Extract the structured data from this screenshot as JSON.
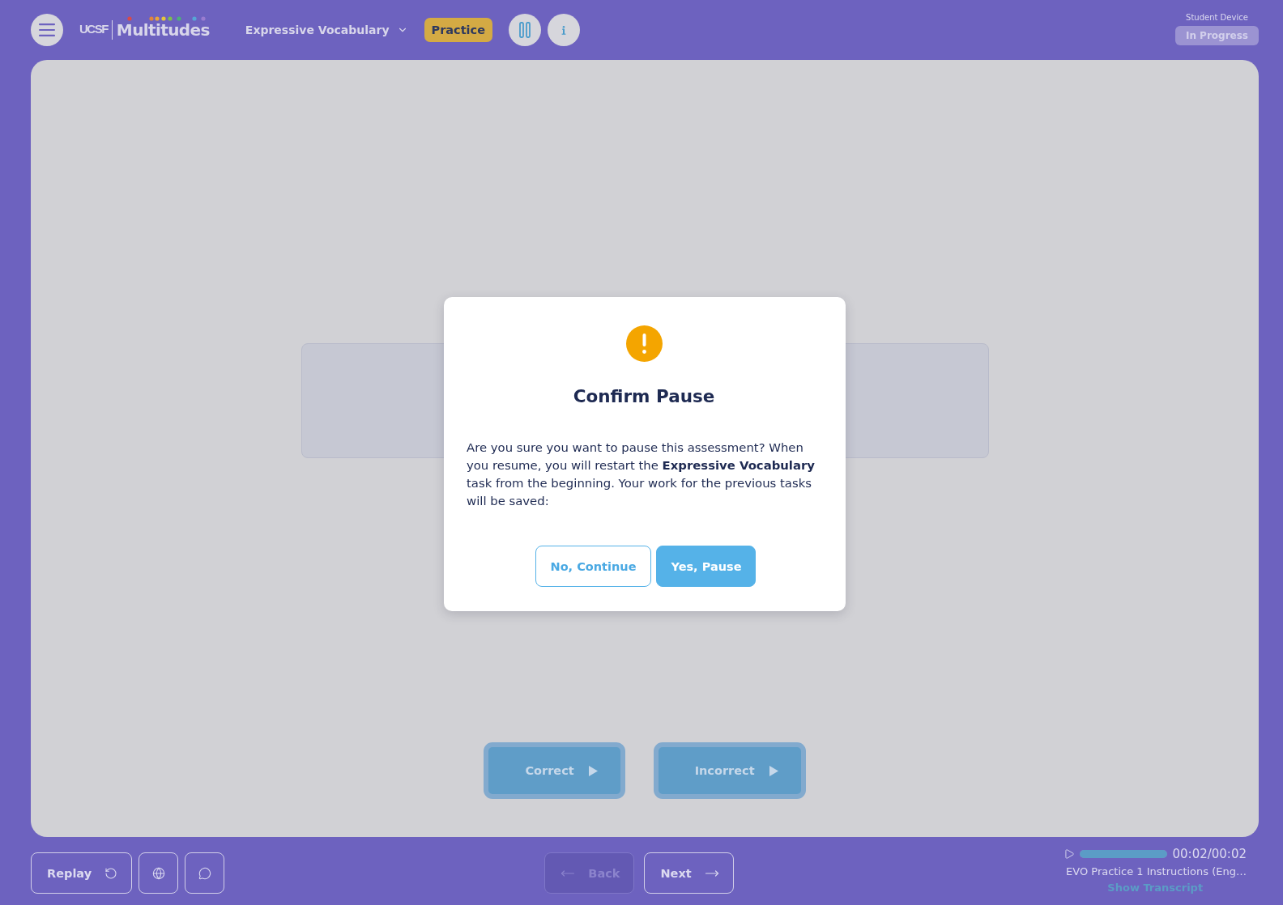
{
  "header": {
    "logo": {
      "prefix": "UCSF",
      "wordmark": "Multitudes"
    },
    "task_selector": {
      "label": "Expressive Vocabulary"
    },
    "mode_badge": "Practice",
    "device_label": "Student Device",
    "status_badge": "In Progress"
  },
  "stage": {
    "response_buttons": [
      {
        "label": "Correct"
      },
      {
        "label": "Incorrect"
      }
    ]
  },
  "dialog": {
    "title": "Confirm Pause",
    "message": "Are you sure you want to pause this assessment? When you resume, you will restart the **Expressive Vocabulary** task from the beginning. Your work for the previous tasks will be saved:",
    "buttons": [
      {
        "label": "No, Continue",
        "kind": "secondary"
      },
      {
        "label": "Yes, Pause",
        "kind": "primary"
      }
    ]
  },
  "footer": {
    "replay_button": {
      "label": "Replay"
    },
    "back_button": {
      "label": "Back",
      "disabled": true
    },
    "next_button": {
      "label": "Next",
      "disabled": false
    },
    "audio": {
      "level": 1,
      "time": "00:02/00:02",
      "title": "EVO Practice 1 Instructions (Eng…",
      "transcript_link": "Show Transcript"
    }
  }
}
